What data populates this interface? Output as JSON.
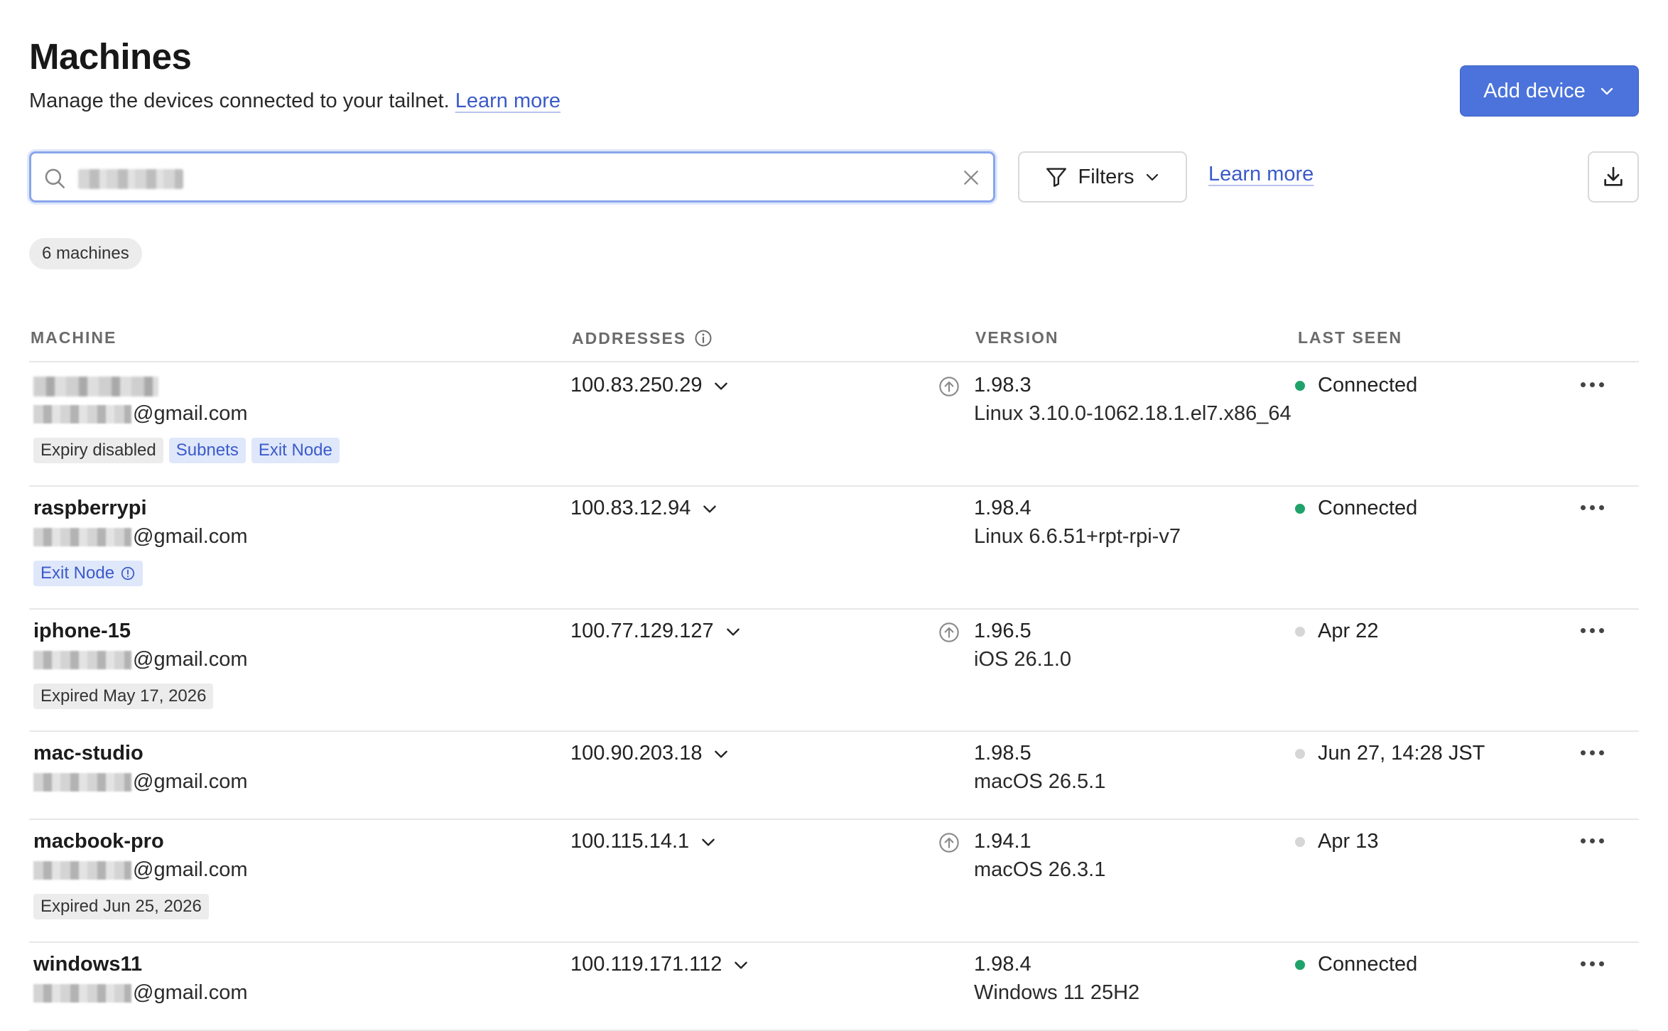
{
  "header": {
    "title": "Machines",
    "subtitle": "Manage the devices connected to your tailnet.",
    "learn_more": "Learn more",
    "add_device": "Add device"
  },
  "toolbar": {
    "filters_label": "Filters",
    "learn_more": "Learn more",
    "search_icon": "search-icon",
    "clear_icon": "close-icon",
    "download_icon": "download-icon"
  },
  "summary": {
    "count_label": "6 machines"
  },
  "table": {
    "headers": {
      "machine": "MACHINE",
      "addresses": "ADDRESSES",
      "version": "VERSION",
      "last_seen": "LAST SEEN"
    },
    "email_suffix": "@gmail.com",
    "rows": [
      {
        "name": "",
        "ip": "100.83.250.29",
        "update_available": true,
        "version": "1.98.3",
        "os": "Linux 3.10.0-1062.18.1.el7.x86_64",
        "last_seen": "Connected",
        "online": true,
        "tags": [
          {
            "label": "Expiry disabled",
            "style": "gray"
          },
          {
            "label": "Subnets",
            "style": "blue"
          },
          {
            "label": "Exit Node",
            "style": "blue"
          }
        ]
      },
      {
        "name": "raspberrypi",
        "ip": "100.83.12.94",
        "update_available": false,
        "version": "1.98.4",
        "os": "Linux 6.6.51+rpt-rpi-v7",
        "last_seen": "Connected",
        "online": true,
        "tags": [
          {
            "label": "Exit Node",
            "style": "blue",
            "info": true
          }
        ]
      },
      {
        "name": "iphone-15",
        "ip": "100.77.129.127",
        "update_available": true,
        "version": "1.96.5",
        "os": "iOS 26.1.0",
        "last_seen": "Apr 22",
        "online": false,
        "tags": [
          {
            "label": "Expired May 17, 2026",
            "style": "gray"
          }
        ]
      },
      {
        "name": "mac-studio",
        "ip": "100.90.203.18",
        "update_available": false,
        "version": "1.98.5",
        "os": "macOS 26.5.1",
        "last_seen": "Jun 27, 14:28 JST",
        "online": false,
        "tags": []
      },
      {
        "name": "macbook-pro",
        "ip": "100.115.14.1",
        "update_available": true,
        "version": "1.94.1",
        "os": "macOS 26.3.1",
        "last_seen": "Apr 13",
        "online": false,
        "tags": [
          {
            "label": "Expired Jun 25, 2026",
            "style": "gray"
          }
        ]
      },
      {
        "name": "windows11",
        "ip": "100.119.171.112",
        "update_available": false,
        "version": "1.98.4",
        "os": "Windows 11 25H2",
        "last_seen": "Connected",
        "online": true,
        "tags": []
      }
    ]
  },
  "colors": {
    "accent": "#4b73db",
    "link": "#3b5bc9",
    "online": "#1fa36a",
    "offline": "#d6d6d6"
  }
}
